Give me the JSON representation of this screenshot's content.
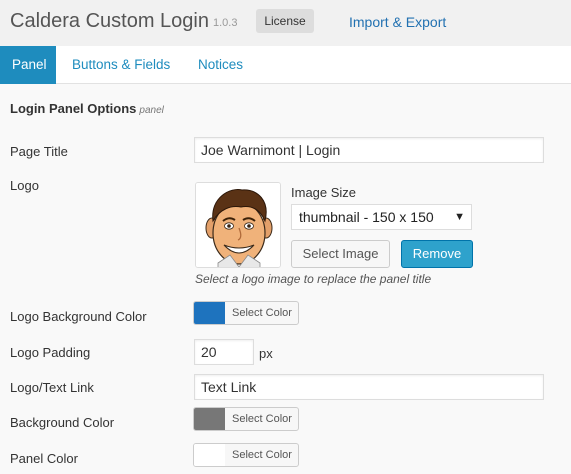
{
  "header": {
    "title": "Caldera Custom Login",
    "version": "1.0.3",
    "license_label": "License",
    "import_export_label": "Import & Export"
  },
  "tabs": [
    {
      "label": "Panel"
    },
    {
      "label": "Buttons & Fields"
    },
    {
      "label": "Notices"
    }
  ],
  "section": {
    "title": "Login Panel Options",
    "subtitle": "panel"
  },
  "fields": {
    "page_title": {
      "label": "Page Title",
      "value": "Joe Warnimont | Login"
    },
    "logo": {
      "label": "Logo",
      "image_size_label": "Image Size",
      "image_size_value": "thumbnail - 150 x 150",
      "select_image_label": "Select Image",
      "remove_label": "Remove",
      "hint": "Select a logo image to replace the panel title"
    },
    "logo_bg_color": {
      "label": "Logo Background Color",
      "button_label": "Select Color",
      "color": "#1e73be"
    },
    "logo_padding": {
      "label": "Logo Padding",
      "value": "20",
      "unit": "px"
    },
    "logo_text_link": {
      "label": "Logo/Text Link",
      "value": "Text Link"
    },
    "background_color": {
      "label": "Background Color",
      "button_label": "Select Color",
      "color": "#777777"
    },
    "panel_color": {
      "label": "Panel Color",
      "button_label": "Select Color",
      "color": "#ffffff"
    }
  },
  "colors": {
    "accent": "#1e8cbe",
    "link": "#2271b1",
    "button_primary": "#2ea2cc"
  }
}
